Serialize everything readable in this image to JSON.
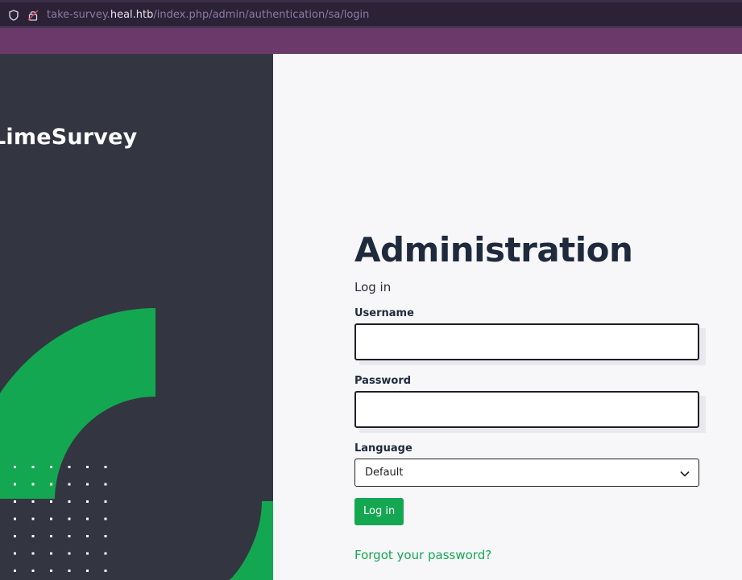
{
  "browser": {
    "url_prefix": "take-survey.",
    "url_host": "heal.htb",
    "url_path": "/index.php/admin/authentication/sa/login"
  },
  "brand": {
    "name": "LimeSurvey"
  },
  "login": {
    "title": "Administration",
    "subtitle": "Log in",
    "username_label": "Username",
    "username_value": "",
    "password_label": "Password",
    "password_value": "",
    "language_label": "Language",
    "language_selected": "Default",
    "submit_label": "Log in",
    "forgot_link": "Forgot your password?"
  },
  "colors": {
    "accent_green": "#14a751",
    "dark_panel": "#333641",
    "title_text": "#1f2a3c"
  },
  "icons": {
    "url_shield": "shield-icon",
    "url_lock": "lock-insecure-icon",
    "select_chevron": "chevron-down-icon"
  }
}
